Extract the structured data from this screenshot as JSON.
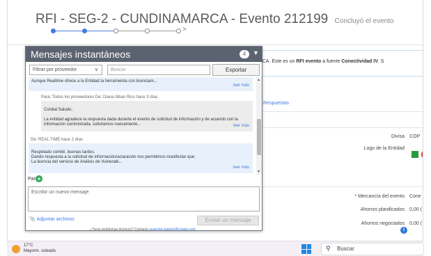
{
  "header": {
    "title": "RFI - SEG-2 - CUNDINAMARCA - Evento 212199",
    "status": "Concluyó el evento"
  },
  "background": {
    "notice_prefix": "ARCA. Este es un ",
    "notice_bold1": "RFI evento",
    "notice_mid": " a fuente ",
    "notice_bold2": "Conectividad IV",
    "notice_suffix": ". S",
    "responses_tab": "Respuestas",
    "divisa_label": "Divisa",
    "divisa_value": "COP",
    "logo_label": "Logo de la Entidad",
    "mercancia_label": "Mercancía del evento",
    "mercancia_value": "Cone",
    "ahorros_plan_label": "Ahorros planificados",
    "ahorros_plan_value": "0,00 (",
    "ahorros_neg_label": "Ahorros negociados",
    "ahorros_neg_value": "0,00 ("
  },
  "chat": {
    "title": "Mensajes instantáneos",
    "count": "4",
    "filter_label": "Filtrar por proveedor",
    "search_placeholder": "Buscar",
    "export_label": "Exportar",
    "messages": [
      {
        "meta": "",
        "body": "Aunque Realtime ofrece a la Entidad la herramienta con licenciam...",
        "more": "leer más"
      },
      {
        "meta": "Para: Todos los proveedores De: Diana Alban Rico hace 3 días",
        "body": "Cordial Saludo,\n\nLa entidad agradece la respuesta dada durante el evento de solicitud de información y de acuerdo con la información suministrada, solicitamos nuevamente...",
        "more": "leer más"
      },
      {
        "meta": "De: REAL TIME hace 2 días",
        "body": "Respetado comité, buenas tardes.\nDando respuesta a la solicitud de información/aclaración nos permitimos manifestar que:\nLa licencia del servicio de Análisis de Vulnerabi...",
        "more": "leer más"
      }
    ],
    "para_label": "Para",
    "compose_placeholder": "Escribir un nuevo mensaje",
    "attach_label": "Adjuntar archivos",
    "send_label": "Enviar un mensaje",
    "support_prefix": "¿Tiene problemas técnicos? Contacto",
    "support_email": "sourcing.support@coupa.com"
  },
  "taskbar": {
    "temperature": "17°C",
    "weather": "Mayorm. soleado",
    "search_label": "Buscar"
  }
}
